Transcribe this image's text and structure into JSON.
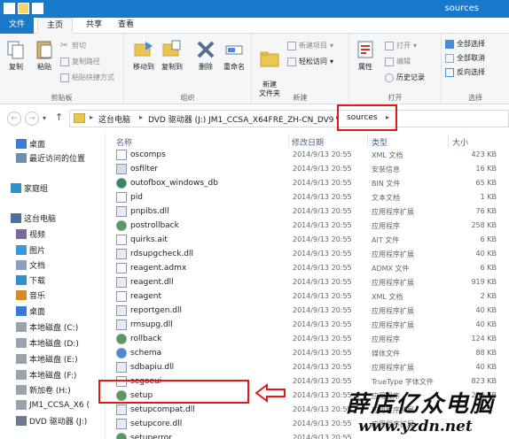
{
  "window": {
    "title": "sources"
  },
  "tabs": {
    "file": "文件",
    "home": "主页",
    "share": "共享",
    "view": "查看"
  },
  "ribbon": {
    "clipboard": {
      "copy": "复制",
      "paste": "粘贴",
      "cut": "剪切",
      "copy_path": "复制路径",
      "paste_shortcut": "粘贴快捷方式",
      "label": "剪贴板"
    },
    "organize": {
      "move_to": "移动到",
      "copy_to": "复制到",
      "delete": "删除",
      "rename": "重命名",
      "label": "组织"
    },
    "new": {
      "new_folder": "新建\n文件夹",
      "new_item": "新建项目",
      "easy_access": "轻松访问",
      "label": "新建"
    },
    "open": {
      "properties": "属性",
      "open": "打开",
      "edit": "编辑",
      "history": "历史记录",
      "label": "打开"
    },
    "select": {
      "select_all": "全部选择",
      "select_none": "全部取消",
      "invert": "反向选择",
      "label": "选择"
    }
  },
  "address": {
    "crumbs": [
      "这台电脑",
      "DVD 驱动器 (J:) JM1_CCSA_X64FRE_ZH-CN_DV9",
      "sources"
    ]
  },
  "nav": [
    {
      "label": "桌面",
      "icon": "desktop-icon"
    },
    {
      "label": "最近访问的位置",
      "icon": "recent-icon"
    },
    {
      "label": "家庭组",
      "icon": "homegroup-icon"
    },
    {
      "label": "这台电脑",
      "icon": "computer-icon"
    },
    {
      "label": "视频",
      "icon": "video-icon"
    },
    {
      "label": "图片",
      "icon": "pictures-icon"
    },
    {
      "label": "文档",
      "icon": "documents-icon"
    },
    {
      "label": "下载",
      "icon": "downloads-icon"
    },
    {
      "label": "音乐",
      "icon": "music-icon"
    },
    {
      "label": "桌面",
      "icon": "desktop-icon"
    },
    {
      "label": "本地磁盘 (C:)",
      "icon": "drive-icon"
    },
    {
      "label": "本地磁盘 (D:)",
      "icon": "drive-icon"
    },
    {
      "label": "本地磁盘 (E:)",
      "icon": "drive-icon"
    },
    {
      "label": "本地磁盘 (F:)",
      "icon": "drive-icon"
    },
    {
      "label": "新加卷 (H:)",
      "icon": "drive-icon"
    },
    {
      "label": "JM1_CCSA_X6 (",
      "icon": "drive-icon"
    },
    {
      "label": "DVD 驱动器 (J:)",
      "icon": "dvd-icon"
    }
  ],
  "columns": {
    "name": "名称",
    "date": "修改日期",
    "type": "类型",
    "size": "大小"
  },
  "files": [
    {
      "name": "oscomps",
      "date": "2014/9/13 20:55",
      "type": "XML 文档",
      "size": "423 KB",
      "icon": "xml-icon"
    },
    {
      "name": "osfilter",
      "date": "2014/9/13 20:55",
      "type": "安装信息",
      "size": "16 KB",
      "icon": "inf-icon"
    },
    {
      "name": "outofbox_windows_db",
      "date": "2014/9/13 20:55",
      "type": "BIN 文件",
      "size": "65 KB",
      "icon": "bin-icon"
    },
    {
      "name": "pid",
      "date": "2014/9/13 20:55",
      "type": "文本文档",
      "size": "1 KB",
      "icon": "text-icon"
    },
    {
      "name": "pnpibs.dll",
      "date": "2014/9/13 20:55",
      "type": "应用程序扩展",
      "size": "76 KB",
      "icon": "dll-icon"
    },
    {
      "name": "postrollback",
      "date": "2014/9/13 20:55",
      "type": "应用程序",
      "size": "258 KB",
      "icon": "exe-icon"
    },
    {
      "name": "quirks.ait",
      "date": "2014/9/13 20:55",
      "type": "AIT 文件",
      "size": "6 KB",
      "icon": "file-icon"
    },
    {
      "name": "rdsupgcheck.dll",
      "date": "2014/9/13 20:55",
      "type": "应用程序扩展",
      "size": "40 KB",
      "icon": "dll-icon"
    },
    {
      "name": "reagent.admx",
      "date": "2014/9/13 20:55",
      "type": "ADMX 文件",
      "size": "6 KB",
      "icon": "file-icon"
    },
    {
      "name": "reagent.dll",
      "date": "2014/9/13 20:55",
      "type": "应用程序扩展",
      "size": "919 KB",
      "icon": "dll-icon"
    },
    {
      "name": "reagent",
      "date": "2014/9/13 20:55",
      "type": "XML 文档",
      "size": "2 KB",
      "icon": "xml-icon"
    },
    {
      "name": "reportgen.dll",
      "date": "2014/9/13 20:55",
      "type": "应用程序扩展",
      "size": "40 KB",
      "icon": "dll-icon"
    },
    {
      "name": "rmsupg.dll",
      "date": "2014/9/13 20:55",
      "type": "应用程序扩展",
      "size": "40 KB",
      "icon": "dll-icon"
    },
    {
      "name": "rollback",
      "date": "2014/9/13 20:55",
      "type": "应用程序",
      "size": "124 KB",
      "icon": "exe-icon"
    },
    {
      "name": "schema",
      "date": "2014/9/13 20:55",
      "type": "媒体文件",
      "size": "88 KB",
      "icon": "media-icon"
    },
    {
      "name": "sdbapiu.dll",
      "date": "2014/9/13 20:55",
      "type": "应用程序扩展",
      "size": "40 KB",
      "icon": "dll-icon"
    },
    {
      "name": "segoeui",
      "date": "2014/9/13 20:55",
      "type": "TrueType 字体文件",
      "size": "823 KB",
      "icon": "font-icon"
    },
    {
      "name": "setup",
      "date": "2014/9/13 20:55",
      "type": "应用程序",
      "size": "286 KB",
      "icon": "exe-icon"
    },
    {
      "name": "setupcompat.dll",
      "date": "2014/9/13 20:55",
      "type": "应用程序扩展",
      "size": "",
      "icon": "dll-icon"
    },
    {
      "name": "setupcore.dll",
      "date": "2014/9/13 20:55",
      "type": "应用程序扩展",
      "size": "",
      "icon": "dll-icon"
    },
    {
      "name": "setuperror",
      "date": "2014/9/13 20:55",
      "type": "",
      "size": "",
      "icon": "exe-icon"
    }
  ],
  "watermark": {
    "line1": "薛店亿众电脑",
    "line2": "www.yzdn.net"
  },
  "colors": {
    "accent": "#1979ca",
    "highlight": "#e01818"
  }
}
